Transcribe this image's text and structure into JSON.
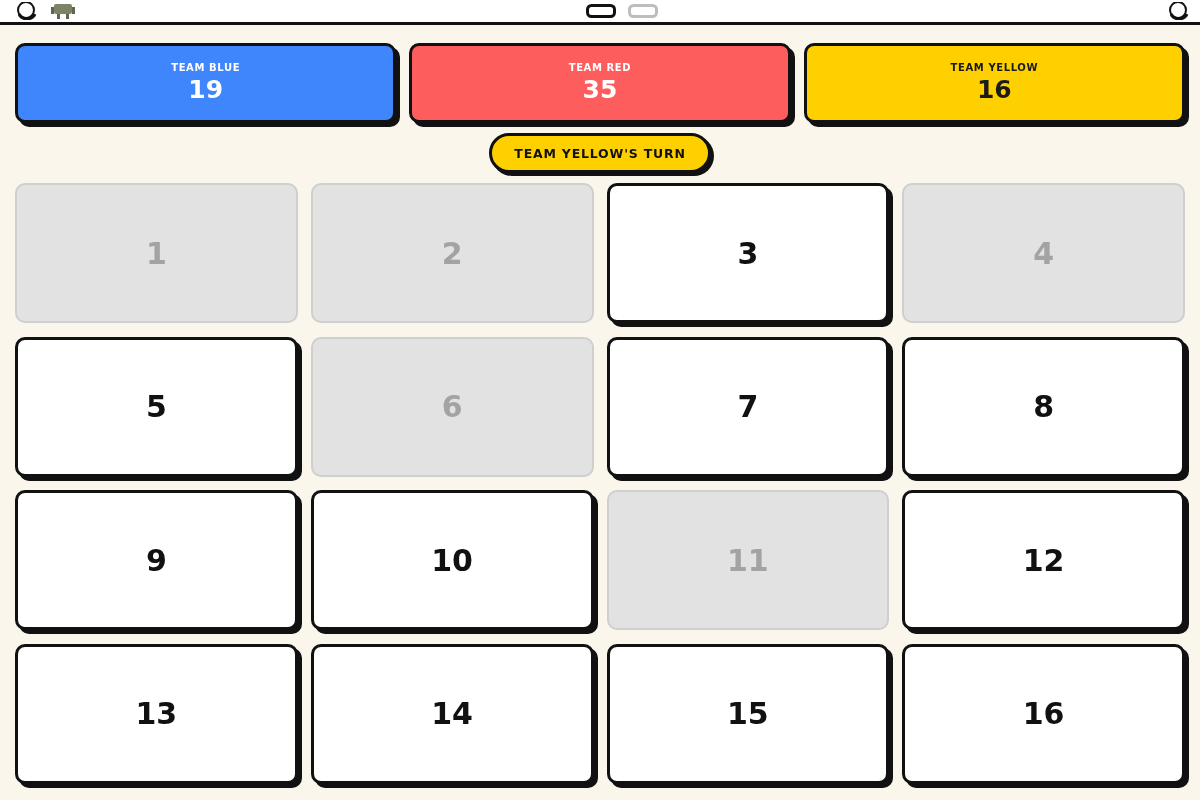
{
  "teams": [
    {
      "name": "TEAM BLUE",
      "score": "19",
      "color": "#3f85fb"
    },
    {
      "name": "TEAM RED",
      "score": "35",
      "color": "#fe5d5d"
    },
    {
      "name": "TEAM YELLOW",
      "score": "16",
      "color": "#ffd000"
    }
  ],
  "turn": {
    "label": "TEAM YELLOW'S TURN"
  },
  "tiles": [
    {
      "number": "1",
      "disabled": true
    },
    {
      "number": "2",
      "disabled": true
    },
    {
      "number": "3",
      "disabled": false
    },
    {
      "number": "4",
      "disabled": true
    },
    {
      "number": "5",
      "disabled": false
    },
    {
      "number": "6",
      "disabled": true
    },
    {
      "number": "7",
      "disabled": false
    },
    {
      "number": "8",
      "disabled": false
    },
    {
      "number": "9",
      "disabled": false
    },
    {
      "number": "10",
      "disabled": false
    },
    {
      "number": "11",
      "disabled": true
    },
    {
      "number": "12",
      "disabled": false
    },
    {
      "number": "13",
      "disabled": false
    },
    {
      "number": "14",
      "disabled": false
    },
    {
      "number": "15",
      "disabled": false
    },
    {
      "number": "16",
      "disabled": false
    }
  ]
}
